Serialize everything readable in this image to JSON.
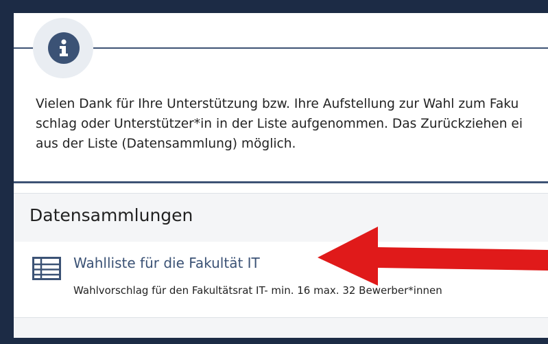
{
  "info": {
    "icon": "info-icon",
    "message_lines": [
      "Vielen Dank für Ihre Unterstützung bzw. Ihre Aufstellung zur Wahl zum Faku",
      "schlag oder Unterstützer*in in der Liste aufgenommen. Das Zurückziehen ei",
      "aus der Liste (Datensammlung) möglich."
    ]
  },
  "datensammlungen": {
    "heading": "Datensammlungen",
    "items": [
      {
        "icon": "table-icon",
        "title": "Wahlliste für die Fakultät IT",
        "description": "Wahlvorschlag für den Fakultätsrat IT- min. 16 max. 32 Bewerber*innen"
      }
    ]
  },
  "annotation": {
    "icon": "red-arrow-icon",
    "color": "#e01a1a"
  },
  "colors": {
    "frame": "#1c2b45",
    "accent": "#3b5275",
    "info_circle_bg": "#e9edf2",
    "section_bg": "#f4f5f7"
  }
}
